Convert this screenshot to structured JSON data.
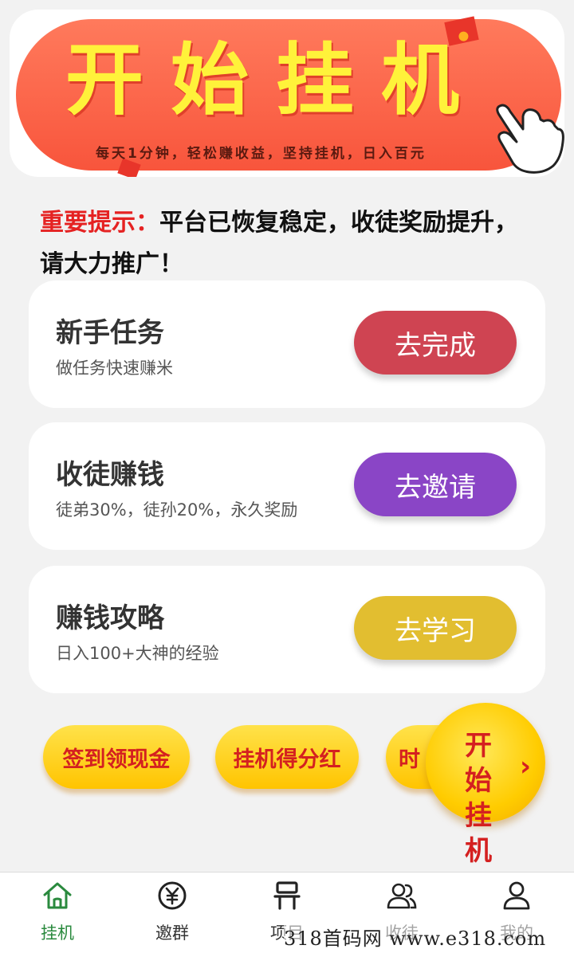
{
  "banner": {
    "title": "开始挂机",
    "subtitle": "每天1分钟，轻松赚收益，坚持挂机，日入百元"
  },
  "notice": {
    "highlight": "重要提示：",
    "text": "平台已恢复稳定，收徒奖励提升，请大力推广！"
  },
  "cards": [
    {
      "title": "新手任务",
      "desc": "做任务快速赚米",
      "button": "去完成",
      "color": "#cf4452"
    },
    {
      "title": "收徒赚钱",
      "desc": "徒弟30%，徒孙20%，永久奖励",
      "button": "去邀请",
      "color": "#8a45c6"
    },
    {
      "title": "赚钱攻略",
      "desc": "日入100+大神的经验",
      "button": "去学习",
      "color": "#e2be30"
    }
  ],
  "pills": [
    "签到领现金",
    "挂机得分红",
    "时"
  ],
  "float_button": {
    "label": "开始挂机",
    "chevron": "›"
  },
  "tabs": [
    {
      "label": "挂机",
      "icon": "home-icon",
      "active": true
    },
    {
      "label": "邀群",
      "icon": "yuan-coin-icon",
      "active": false
    },
    {
      "label": "项目",
      "icon": "project-icon",
      "active": false
    },
    {
      "label": "收徒",
      "icon": "users-icon",
      "active": false
    },
    {
      "label": "我的",
      "icon": "user-icon",
      "active": false
    }
  ],
  "watermark": "318首码网 www.e318.com",
  "colors": {
    "accent_green": "#2a8a3e",
    "alert_red": "#e52222",
    "banner_red": "#f8553c",
    "banner_yellow": "#fff23a"
  }
}
